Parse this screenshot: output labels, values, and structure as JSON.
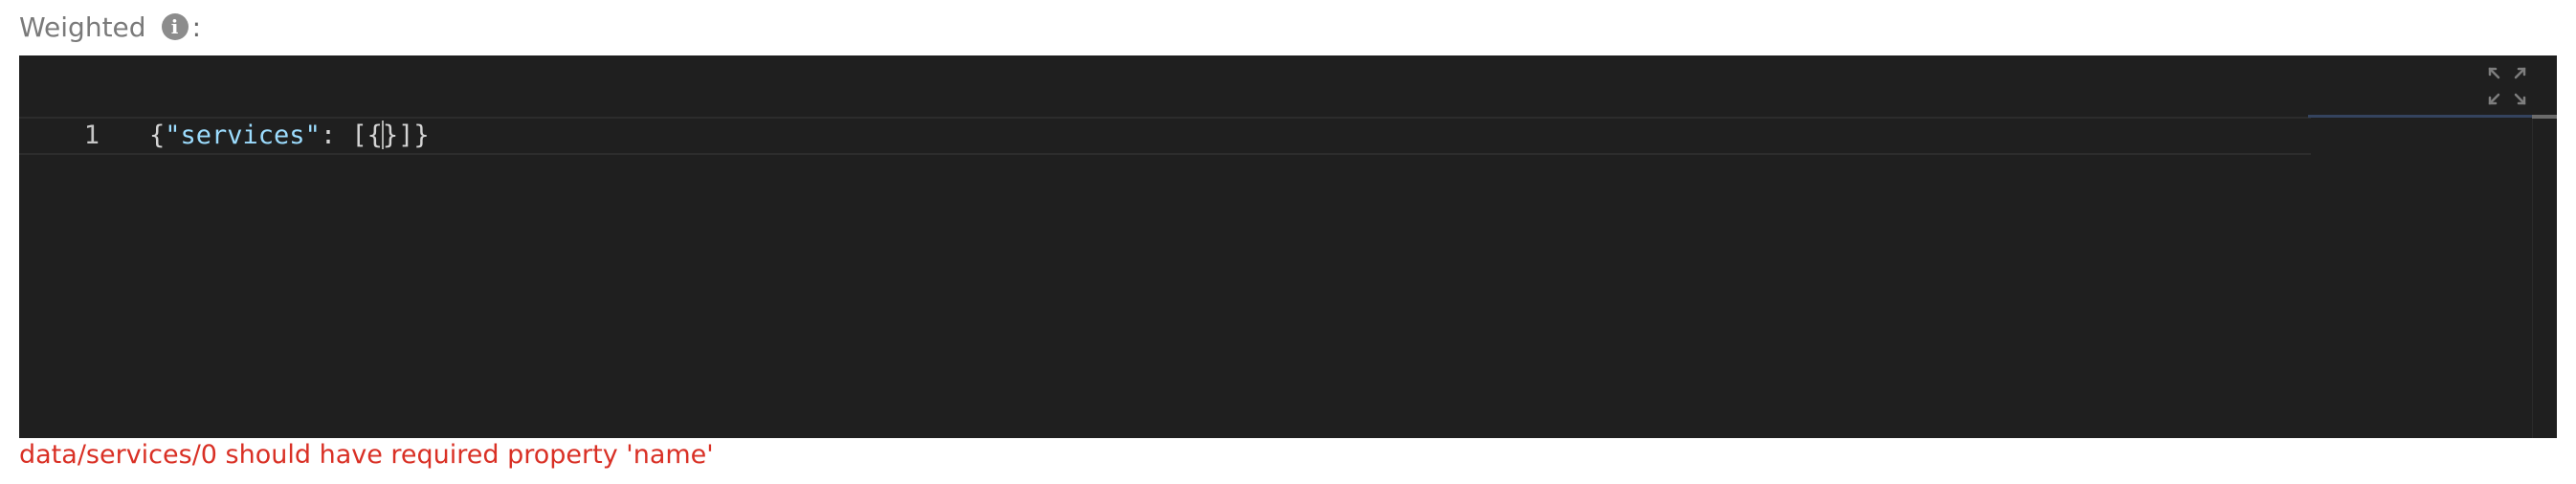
{
  "field": {
    "label": "Weighted",
    "info_icon_glyph": "i",
    "colon": ":",
    "info_icon_name": "info-icon"
  },
  "editor": {
    "line_number": "1",
    "code": {
      "open_brace": "{",
      "key": "\"services\"",
      "colon": ": ",
      "open_bracket": "[",
      "inner_open": "{",
      "inner_close": "}",
      "close": "]}"
    },
    "fullscreen_icon_name": "expand-icon",
    "colors": {
      "background": "#1f1f1f",
      "key": "#9cdcfe",
      "text": "#d4d4d4"
    }
  },
  "validation": {
    "error": "data/services/0 should have required property 'name'",
    "color": "#d93025"
  }
}
